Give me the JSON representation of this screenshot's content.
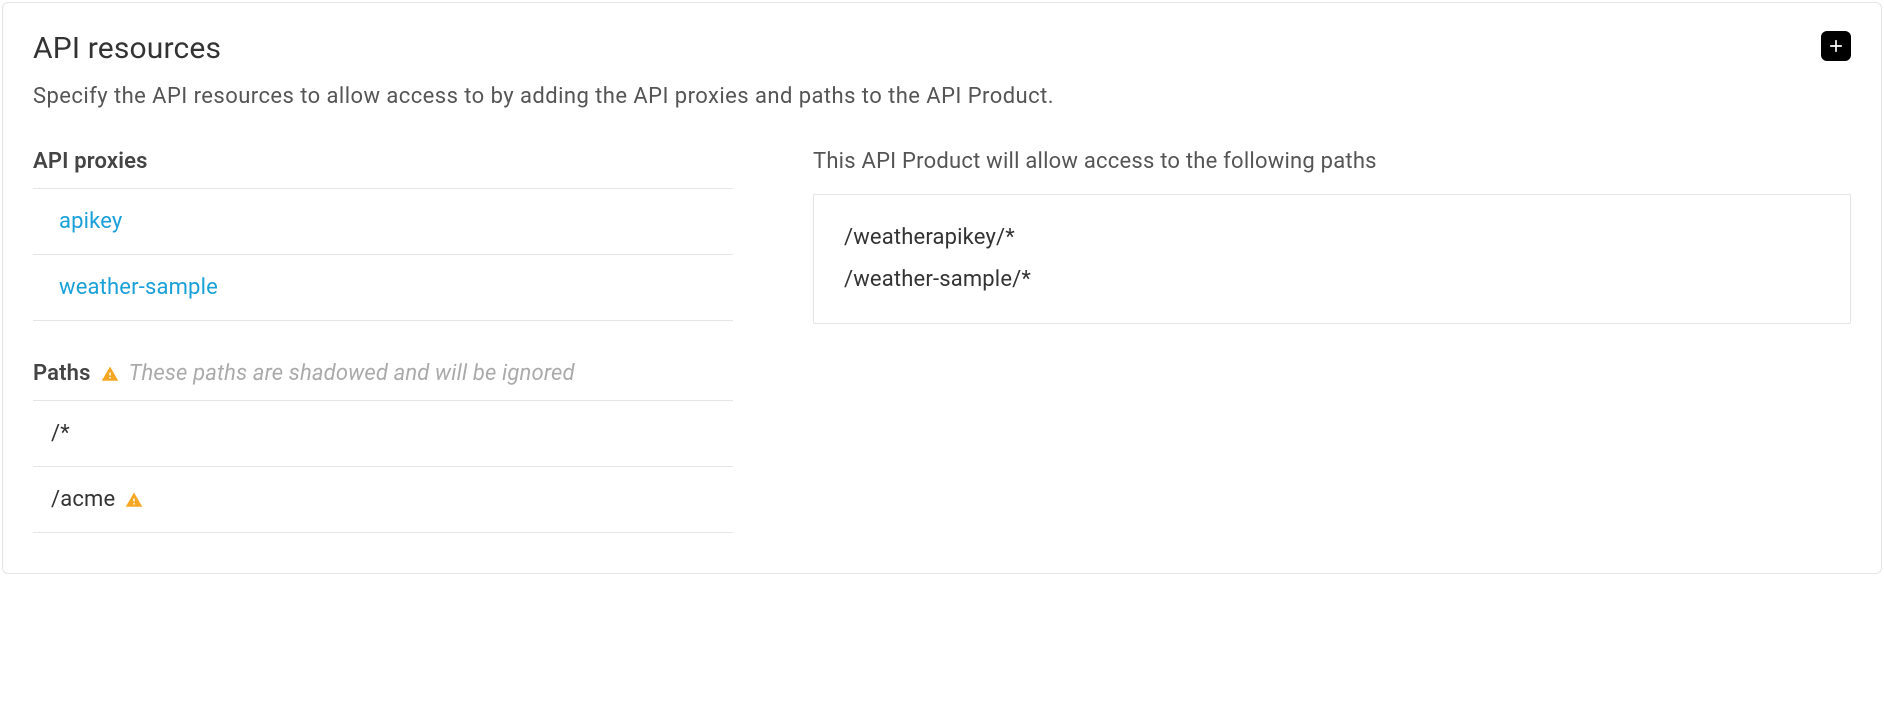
{
  "panel": {
    "title": "API resources",
    "description": "Specify the API resources to allow access to by adding the API proxies and paths to the API Product."
  },
  "proxies": {
    "header": "API proxies",
    "items": [
      "apikey",
      "weather-sample"
    ]
  },
  "paths": {
    "header": "Paths",
    "warning_note": "These paths are shadowed and will be ignored",
    "items": [
      {
        "path": "/*",
        "warn": false
      },
      {
        "path": "/acme",
        "warn": true
      }
    ]
  },
  "allowed": {
    "header": "This API Product will allow access to the following paths",
    "items": [
      "/weatherapikey/*",
      "/weather-sample/*"
    ]
  }
}
